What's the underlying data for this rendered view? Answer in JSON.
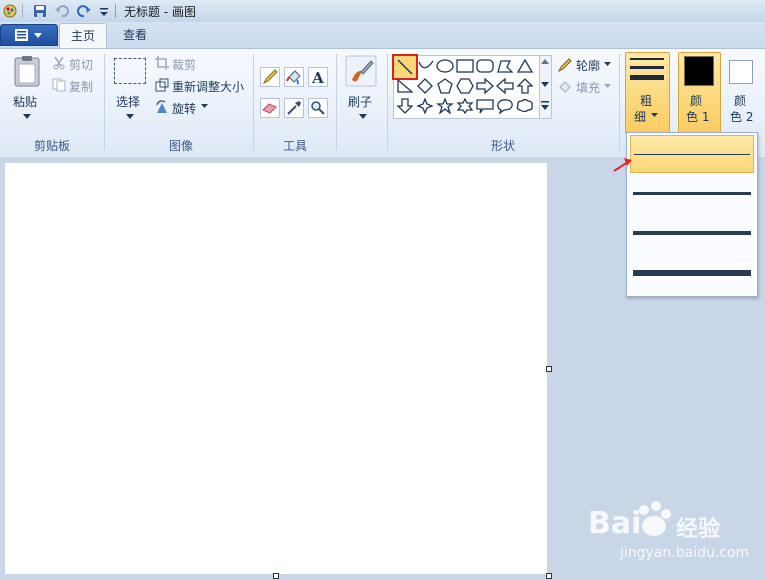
{
  "window": {
    "title": "无标题 - 画图"
  },
  "tabs": [
    {
      "label": "主页"
    },
    {
      "label": "查看"
    }
  ],
  "clipboard": {
    "paste": "粘贴",
    "cut": "剪切",
    "copy": "复制",
    "group": "剪贴板"
  },
  "image": {
    "select": "选择",
    "crop": "裁剪",
    "resize": "重新调整大小",
    "rotate": "旋转",
    "group": "图像"
  },
  "tools": {
    "group": "工具"
  },
  "brushes": {
    "label": "刷子"
  },
  "shapes": {
    "outline": "轮廓",
    "fill": "填充",
    "group": "形状"
  },
  "size": {
    "label1": "粗",
    "label2": "细"
  },
  "colors": {
    "color1_l1": "颜",
    "color1_l2": "色 1",
    "color2_l1": "颜",
    "color2_l2": "色 2",
    "color1_value": "#000000",
    "color2_value": "#ffffff"
  },
  "watermark": {
    "text": "Bai",
    "text2": "经验",
    "url": "jingyan.baidu.com"
  }
}
